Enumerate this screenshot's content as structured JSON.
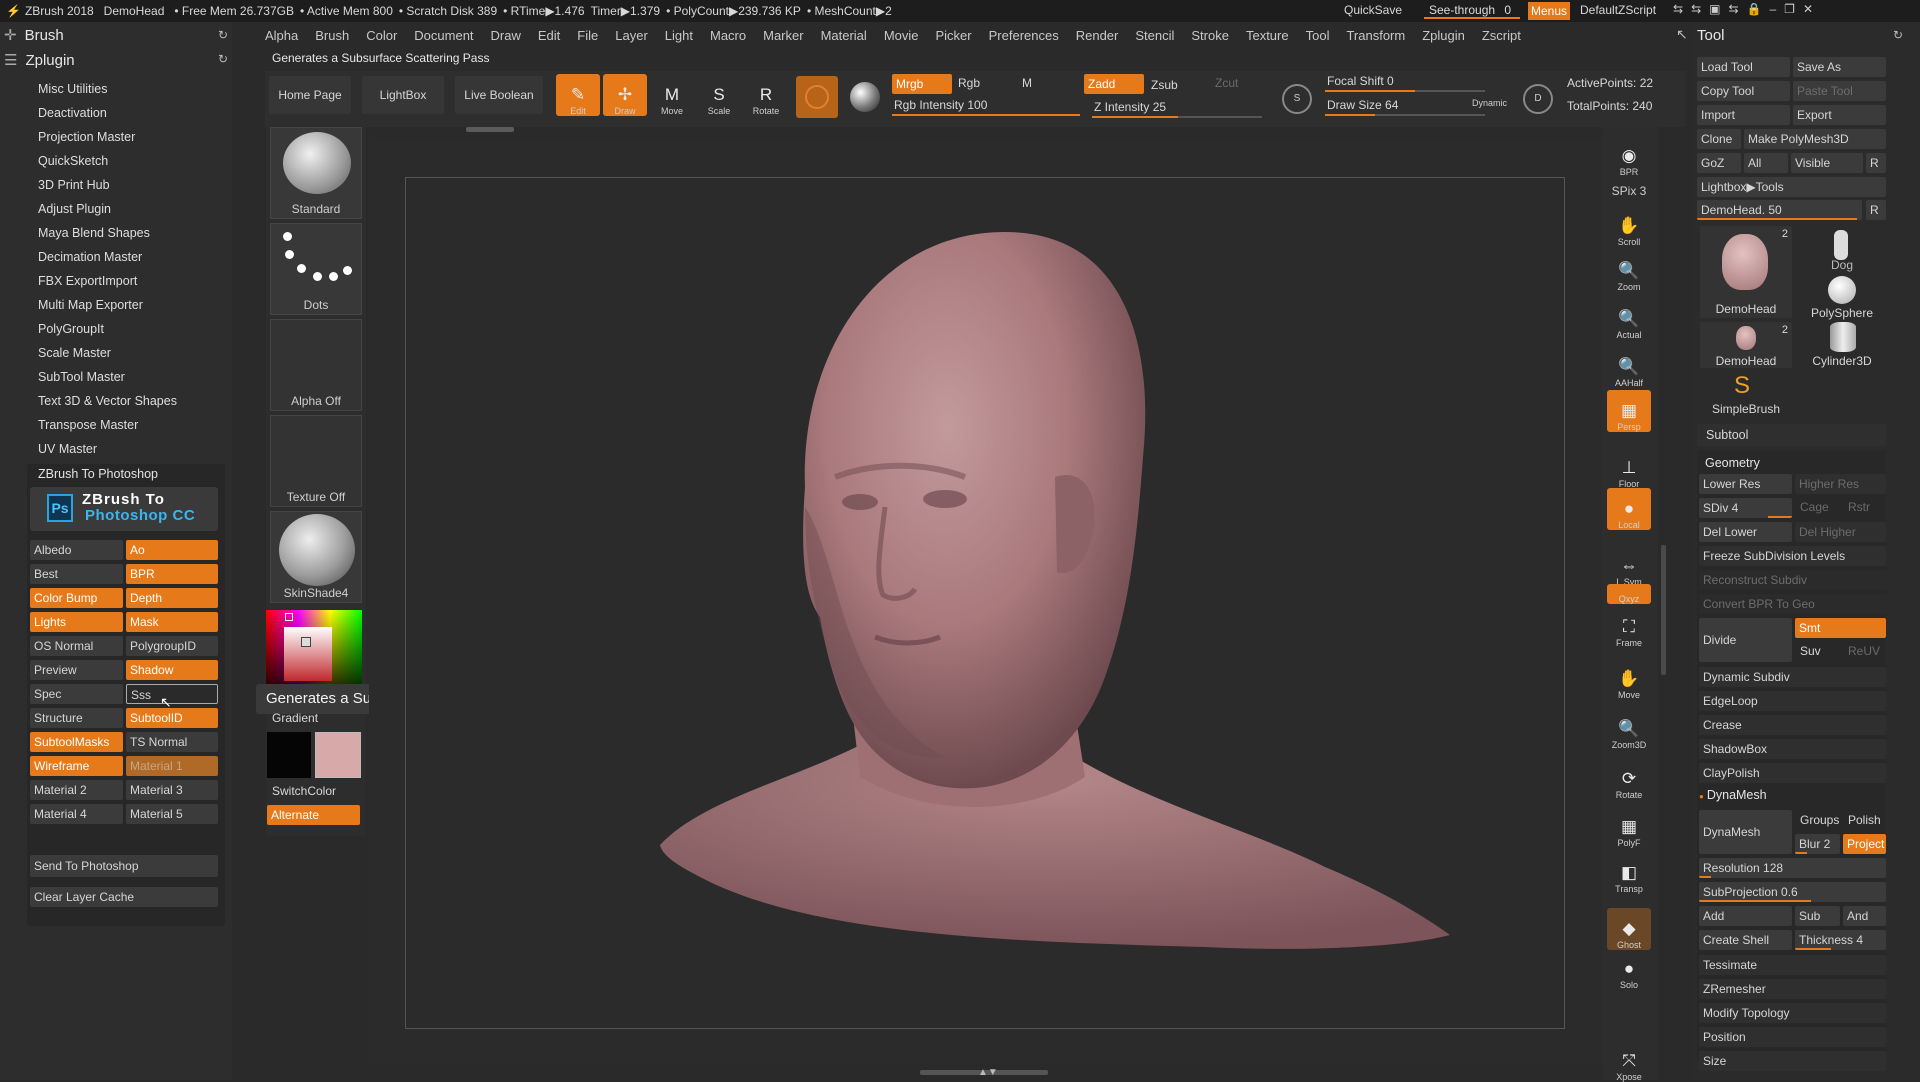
{
  "topbar": {
    "app": "ZBrush 2018",
    "project": "DemoHead",
    "free_mem": "• Free Mem 26.737GB",
    "active_mem": "• Active Mem 800",
    "scratch": "• Scratch Disk 389",
    "rtime": "• RTime▶1.476",
    "timer": "Timer▶1.379",
    "polycount": "• PolyCount▶239.736 KP",
    "meshcount": "• MeshCount▶2",
    "quicksave": "QuickSave",
    "seethrough": "See-through",
    "seethrough_value": "0",
    "menus": "Menus",
    "script": "DefaultZScript"
  },
  "menu": [
    "Alpha",
    "Brush",
    "Color",
    "Document",
    "Draw",
    "Edit",
    "File",
    "Layer",
    "Light",
    "Macro",
    "Marker",
    "Material",
    "Movie",
    "Picker",
    "Preferences",
    "Render",
    "Stencil",
    "Stroke",
    "Texture",
    "Tool",
    "Transform",
    "Zplugin",
    "Zscript"
  ],
  "hint_text": "Generates a Subsurface Scattering Pass",
  "left": {
    "brush_title": "Brush",
    "zplugin_title": "Zplugin",
    "plugins": [
      "Misc Utilities",
      "Deactivation",
      "Projection Master",
      "QuickSketch",
      "3D Print Hub",
      "Adjust Plugin",
      "Maya Blend Shapes",
      "Decimation Master",
      "FBX ExportImport",
      "Multi Map Exporter",
      "PolyGroupIt",
      "Scale Master",
      "SubTool Master",
      "Text 3D & Vector Shapes",
      "Transpose Master",
      "UV Master"
    ],
    "ztp_title": "ZBrush To Photoshop",
    "ztp_logo_line1": "ZBrush To",
    "ztp_logo_line2": "Photoshop CC",
    "ps_badge": "Ps",
    "passes": [
      {
        "left": "Albedo",
        "left_on": false,
        "right": "Ao",
        "right_on": true
      },
      {
        "left": "Best",
        "left_on": false,
        "right": "BPR",
        "right_on": true
      },
      {
        "left": "Color Bump",
        "left_on": true,
        "right": "Depth",
        "right_on": true
      },
      {
        "left": "Lights",
        "left_on": true,
        "right": "Mask",
        "right_on": true
      },
      {
        "left": "OS Normal",
        "left_on": false,
        "right": "PolygroupID",
        "right_on": false
      },
      {
        "left": "Preview",
        "left_on": false,
        "right": "Shadow",
        "right_on": true
      },
      {
        "left": "Spec",
        "left_on": false,
        "right": "Sss",
        "right_on": false
      },
      {
        "left": "Structure",
        "left_on": false,
        "right": "SubtoolID",
        "right_on": true
      },
      {
        "left": "SubtoolMasks",
        "left_on": true,
        "right": "TS Normal",
        "right_on": false
      },
      {
        "left": "Wireframe",
        "left_on": true,
        "right": "Material 1",
        "right_on": true
      },
      {
        "left": "Material 2",
        "left_on": false,
        "right": "Material 3",
        "right_on": false
      },
      {
        "left": "Material 4",
        "left_on": false,
        "right": "Material 5",
        "right_on": false
      }
    ],
    "send": "Send To Photoshop",
    "clear": "Clear Layer Cache"
  },
  "shelf": {
    "home": "Home Page",
    "lightbox": "LightBox",
    "live_boolean": "Live Boolean",
    "edit": "Edit",
    "draw": "Draw",
    "move": "Move",
    "scale": "Scale",
    "rotate": "Rotate",
    "mrgb": "Mrgb",
    "rgb": "Rgb",
    "m": "M",
    "rgb_intensity": "Rgb Intensity 100",
    "zadd": "Zadd",
    "zsub": "Zsub",
    "zcut": "Zcut",
    "z_intensity": "Z Intensity 25",
    "focal": "Focal Shift 0",
    "drawsize": "Draw Size 64",
    "dynamic": "Dynamic",
    "active_points": "ActivePoints: 22",
    "total_points": "TotalPoints: 240"
  },
  "thumbs": {
    "standard": "Standard",
    "dots": "Dots",
    "alpha": "Alpha Off",
    "texture": "Texture Off",
    "material": "SkinShade4",
    "gradient": "Gradient",
    "switchcolor": "SwitchColor",
    "alternate": "Alternate"
  },
  "tooltip": "Generates a Subsurface Scattering Pass",
  "rightbar": [
    {
      "name": "BPR",
      "glyph": "◉"
    },
    {
      "name": "SPix 3",
      "glyph": ""
    },
    {
      "name": "Scroll",
      "glyph": "✋"
    },
    {
      "name": "Zoom",
      "glyph": "🔍"
    },
    {
      "name": "Actual",
      "glyph": "🔍"
    },
    {
      "name": "AAHalf",
      "glyph": "🔍"
    },
    {
      "name": "Persp",
      "glyph": "▦"
    },
    {
      "name": "Floor",
      "glyph": "⊥"
    },
    {
      "name": "Local",
      "glyph": "●"
    },
    {
      "name": "L.Sym",
      "glyph": "⇔"
    },
    {
      "name": "Qxyz",
      "glyph": ""
    },
    {
      "name": "Frame",
      "glyph": "⛶"
    },
    {
      "name": "Move",
      "glyph": "✋"
    },
    {
      "name": "Zoom3D",
      "glyph": "🔍"
    },
    {
      "name": "Rotate",
      "glyph": "⟳"
    },
    {
      "name": "PolyF",
      "glyph": "▦"
    },
    {
      "name": "Transp",
      "glyph": "◧"
    },
    {
      "name": "Ghost",
      "glyph": "◆"
    },
    {
      "name": "Solo",
      "glyph": "●"
    },
    {
      "name": "Xpose",
      "glyph": "⤧"
    }
  ],
  "tool": {
    "title": "Tool",
    "load": "Load Tool",
    "save_as": "Save As",
    "copy": "Copy Tool",
    "paste": "Paste Tool",
    "import": "Import",
    "export": "Export",
    "clone": "Clone",
    "make_polymesh": "Make PolyMesh3D",
    "goz": "GoZ",
    "all": "All",
    "visible": "Visible",
    "r": "R",
    "lightbox_tools": "Lightbox▶Tools",
    "demohead_slider": "DemoHead. 50",
    "items": [
      {
        "label": "DemoHead",
        "badge": "2"
      },
      {
        "label": "Dog",
        "badge": ""
      },
      {
        "label": "PolySphere",
        "badge": ""
      },
      {
        "label": "DemoHead",
        "badge": "2"
      },
      {
        "label": "Cylinder3D",
        "badge": ""
      },
      {
        "label": "SimpleBrush",
        "badge": ""
      }
    ],
    "subtool": "Subtool",
    "geometry": "Geometry",
    "lower_res": "Lower Res",
    "higher_res": "Higher Res",
    "sdiv": "SDiv 4",
    "cage": "Cage",
    "rstr": "Rstr",
    "del_lower": "Del Lower",
    "del_higher": "Del Higher",
    "freeze": "Freeze SubDivision Levels",
    "reconstruct": "Reconstruct Subdiv",
    "convert_bpr": "Convert BPR To Geo",
    "divide": "Divide",
    "smt": "Smt",
    "suv": "Suv",
    "reuv": "ReUV",
    "dynamic_subdiv": "Dynamic Subdiv",
    "edgeloop": "EdgeLoop",
    "crease": "Crease",
    "shadowbox": "ShadowBox",
    "claypolish": "ClayPolish",
    "dynamesh_section": "DynaMesh",
    "dynamesh_btn": "DynaMesh",
    "groups": "Groups",
    "polish": "Polish",
    "blur": "Blur 2",
    "project": "Project",
    "resolution": "Resolution 128",
    "subprojection": "SubProjection 0.6",
    "add": "Add",
    "sub": "Sub",
    "and": "And",
    "create_shell": "Create Shell",
    "thickness": "Thickness 4",
    "tessimate": "Tessimate",
    "zremesher": "ZRemesher",
    "modify_topology": "Modify Topology",
    "position": "Position",
    "size": "Size"
  },
  "colors": {
    "accent": "#e67a1a",
    "panel": "#2d2d2d",
    "canvas": "#2b2b2b",
    "skin": "#b18386"
  }
}
